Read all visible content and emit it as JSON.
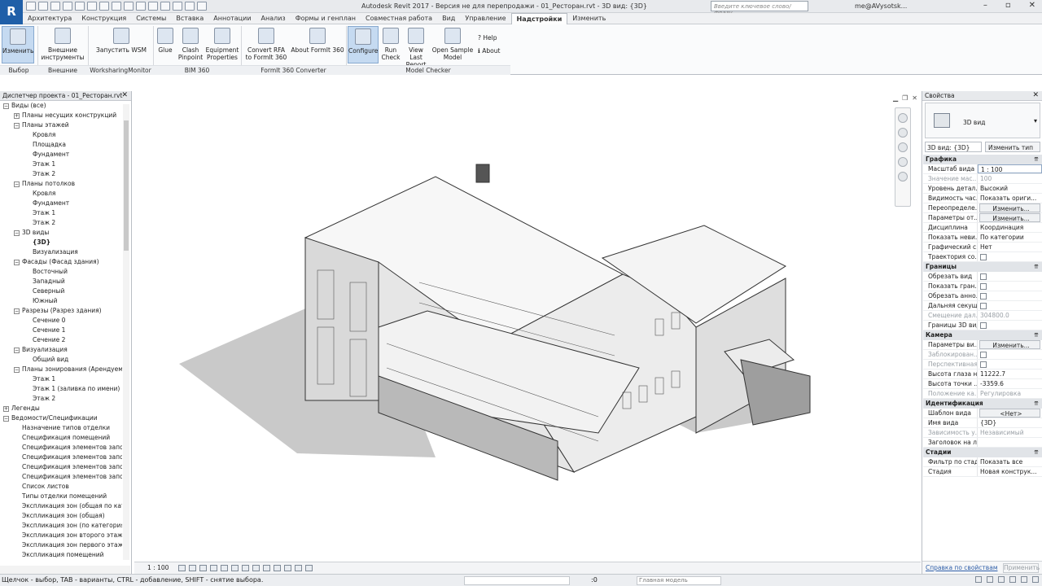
{
  "app": {
    "title": "Autodesk Revit 2017 - Версия не для перепродажи -    01_Ресторан.rvt - 3D вид: {3D}",
    "logo": "R",
    "search_placeholder": "Введите ключевое слово/фразу",
    "user": "me@AVysotsk..."
  },
  "menu": {
    "tabs": [
      "Архитектура",
      "Конструкция",
      "Системы",
      "Вставка",
      "Аннотации",
      "Анализ",
      "Формы и генплан",
      "Совместная работа",
      "Вид",
      "Управление",
      "Надстройки",
      "Изменить"
    ],
    "active": "Надстройки"
  },
  "ribbon": {
    "modify": "Изменить",
    "external_tools": "Внешние инструменты",
    "run_wsm": "Запустить WSM",
    "glue": "Glue",
    "clash_pinpoint": "Clash Pinpoint",
    "equipment_properties": "Equipment Properties",
    "convert_rfa": "Convert RFA to FormIt 360",
    "about_formit": "About FormIt 360",
    "configure": "Configure",
    "run_check": "Run Check",
    "view_last_report": "View Last Report",
    "open_sample_model": "Open Sample Model",
    "help": "Help",
    "about": "About",
    "groups": {
      "select": "Выбор",
      "external": "Внешние",
      "worksharing": "WorksharingMonitor",
      "bim360": "BIM 360",
      "formit": "FormIt 360 Converter",
      "model_checker": "Model Checker"
    }
  },
  "project_browser": {
    "title": "Диспетчер проекта - 01_Ресторан.rvt",
    "nodes": [
      {
        "level": 0,
        "toggle": "−",
        "label": "Виды (все)"
      },
      {
        "level": 1,
        "toggle": "+",
        "label": "Планы несущих конструкций"
      },
      {
        "level": 1,
        "toggle": "−",
        "label": "Планы этажей"
      },
      {
        "level": 2,
        "toggle": "",
        "label": "Кровля"
      },
      {
        "level": 2,
        "toggle": "",
        "label": "Площадка"
      },
      {
        "level": 2,
        "toggle": "",
        "label": "Фундамент"
      },
      {
        "level": 2,
        "toggle": "",
        "label": "Этаж 1"
      },
      {
        "level": 2,
        "toggle": "",
        "label": "Этаж 2"
      },
      {
        "level": 1,
        "toggle": "−",
        "label": "Планы потолков"
      },
      {
        "level": 2,
        "toggle": "",
        "label": "Кровля"
      },
      {
        "level": 2,
        "toggle": "",
        "label": "Фундамент"
      },
      {
        "level": 2,
        "toggle": "",
        "label": "Этаж 1"
      },
      {
        "level": 2,
        "toggle": "",
        "label": "Этаж 2"
      },
      {
        "level": 1,
        "toggle": "−",
        "label": "3D виды"
      },
      {
        "level": 2,
        "toggle": "",
        "label": "{3D}",
        "bold": true
      },
      {
        "level": 2,
        "toggle": "",
        "label": "Визуализация"
      },
      {
        "level": 1,
        "toggle": "−",
        "label": "Фасады (Фасад здания)"
      },
      {
        "level": 2,
        "toggle": "",
        "label": "Восточный"
      },
      {
        "level": 2,
        "toggle": "",
        "label": "Западный"
      },
      {
        "level": 2,
        "toggle": "",
        "label": "Северный"
      },
      {
        "level": 2,
        "toggle": "",
        "label": "Южный"
      },
      {
        "level": 1,
        "toggle": "−",
        "label": "Разрезы (Разрез здания)"
      },
      {
        "level": 2,
        "toggle": "",
        "label": "Сечение 0"
      },
      {
        "level": 2,
        "toggle": "",
        "label": "Сечение 1"
      },
      {
        "level": 2,
        "toggle": "",
        "label": "Сечение 2"
      },
      {
        "level": 1,
        "toggle": "−",
        "label": "Визуализация"
      },
      {
        "level": 2,
        "toggle": "",
        "label": "Общий вид"
      },
      {
        "level": 1,
        "toggle": "−",
        "label": "Планы зонирования (Арендуем"
      },
      {
        "level": 2,
        "toggle": "",
        "label": "Этаж 1"
      },
      {
        "level": 2,
        "toggle": "",
        "label": "Этаж 1 (заливка по имени)"
      },
      {
        "level": 2,
        "toggle": "",
        "label": "Этаж 2"
      },
      {
        "level": 0,
        "toggle": "+",
        "label": "Легенды"
      },
      {
        "level": 0,
        "toggle": "−",
        "label": "Ведомости/Спецификации"
      },
      {
        "level": 1,
        "toggle": "",
        "label": "Назначение типов отделки"
      },
      {
        "level": 1,
        "toggle": "",
        "label": "Спецификация помещений"
      },
      {
        "level": 1,
        "toggle": "",
        "label": "Спецификация элементов запол"
      },
      {
        "level": 1,
        "toggle": "",
        "label": "Спецификация элементов запол"
      },
      {
        "level": 1,
        "toggle": "",
        "label": "Спецификация элементов запол"
      },
      {
        "level": 1,
        "toggle": "",
        "label": "Спецификация элементов запол"
      },
      {
        "level": 1,
        "toggle": "",
        "label": "Список листов"
      },
      {
        "level": 1,
        "toggle": "",
        "label": "Типы отделки помещений"
      },
      {
        "level": 1,
        "toggle": "",
        "label": "Экспликация зон (общая по кат"
      },
      {
        "level": 1,
        "toggle": "",
        "label": "Экспликация зон (общая)"
      },
      {
        "level": 1,
        "toggle": "",
        "label": "Экспликация зон (по категория"
      },
      {
        "level": 1,
        "toggle": "",
        "label": "Экспликация зон второго этаж"
      },
      {
        "level": 1,
        "toggle": "",
        "label": "Экспликация зон первого этаж"
      },
      {
        "level": 1,
        "toggle": "",
        "label": "Экспликация помещений"
      }
    ]
  },
  "viewport": {
    "scale": "1 : 100"
  },
  "properties": {
    "title": "Свойства",
    "type_label": "3D вид",
    "type_selector": "3D вид: {3D}",
    "edit_type": "Изменить тип",
    "sections": [
      {
        "name": "Графика",
        "rows": [
          {
            "k": "Масштаб вида",
            "v": "1 : 100",
            "kind": "input"
          },
          {
            "k": "Значение мас...",
            "v": "100",
            "kind": "dis"
          },
          {
            "k": "Уровень детал...",
            "v": "Высокий"
          },
          {
            "k": "Видимость час...",
            "v": "Показать ориги..."
          },
          {
            "k": "Переопределе...",
            "v": "Изменить...",
            "kind": "btn"
          },
          {
            "k": "Параметры от...",
            "v": "Изменить...",
            "kind": "btn"
          },
          {
            "k": "Дисциплина",
            "v": "Координация"
          },
          {
            "k": "Показать неви...",
            "v": "По категории"
          },
          {
            "k": "Графический с...",
            "v": "Нет"
          },
          {
            "k": "Траектория со...",
            "v": "",
            "kind": "cb"
          }
        ]
      },
      {
        "name": "Границы",
        "rows": [
          {
            "k": "Обрезать вид",
            "v": "",
            "kind": "cb"
          },
          {
            "k": "Показать гран...",
            "v": "",
            "kind": "cb"
          },
          {
            "k": "Обрезать анно...",
            "v": "",
            "kind": "cb"
          },
          {
            "k": "Дальняя секущ...",
            "v": "",
            "kind": "cb"
          },
          {
            "k": "Смещение дал...",
            "v": "304800.0",
            "kind": "dis"
          },
          {
            "k": "Границы 3D вида",
            "v": "",
            "kind": "cb"
          }
        ]
      },
      {
        "name": "Камера",
        "rows": [
          {
            "k": "Параметры ви...",
            "v": "Изменить...",
            "kind": "btn"
          },
          {
            "k": "Заблокирован...",
            "v": "",
            "kind": "discb"
          },
          {
            "k": "Перспективная",
            "v": "",
            "kind": "discb"
          },
          {
            "k": "Высота глаза н...",
            "v": "11222.7"
          },
          {
            "k": "Высота точки ...",
            "v": "-3359.6"
          },
          {
            "k": "Положение ка...",
            "v": "Регулировка",
            "kind": "dis"
          }
        ]
      },
      {
        "name": "Идентификация",
        "rows": [
          {
            "k": "Шаблон вида",
            "v": "<Нет>",
            "kind": "btn"
          },
          {
            "k": "Имя вида",
            "v": "{3D}"
          },
          {
            "k": "Зависимость у...",
            "v": "Независимый",
            "kind": "dis"
          },
          {
            "k": "Заголовок на л...",
            "v": ""
          }
        ]
      },
      {
        "name": "Стадии",
        "rows": [
          {
            "k": "Фильтр по стад...",
            "v": "Показать все"
          },
          {
            "k": "Стадия",
            "v": "Новая конструк..."
          }
        ]
      }
    ],
    "help_link": "Справка по свойствам",
    "apply": "Применить"
  },
  "status": {
    "message": "Щелчок - выбор, TAB - варианты, CTRL - добавление, SHIFT - снятие выбора.",
    "count": ":0",
    "model": "Главная модель"
  }
}
